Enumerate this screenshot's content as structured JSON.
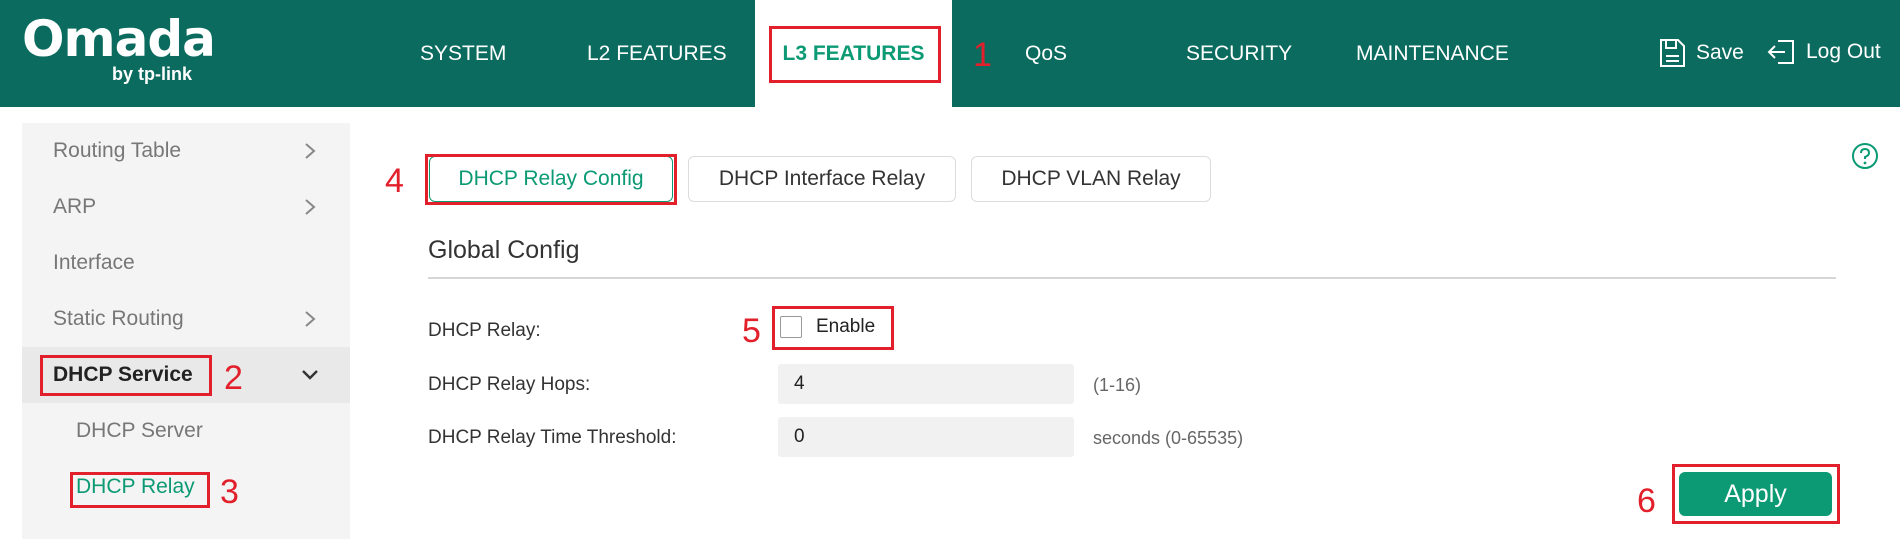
{
  "header": {
    "logo_text": "Omada",
    "logo_sub": "by tp-link",
    "nav": [
      {
        "label": "SYSTEM"
      },
      {
        "label": "L2 FEATURES"
      },
      {
        "label": "L3 FEATURES",
        "active": true
      },
      {
        "label": "QoS"
      },
      {
        "label": "SECURITY"
      },
      {
        "label": "MAINTENANCE"
      }
    ],
    "save_label": "Save",
    "save_icon": "save-icon",
    "logout_label": "Log Out",
    "logout_icon": "logout-icon",
    "bg_color": "#0b6b5e"
  },
  "sidebar": {
    "items": [
      {
        "label": "Routing Table",
        "has_chevron": true
      },
      {
        "label": "ARP",
        "has_chevron": true
      },
      {
        "label": "Interface",
        "has_chevron": false
      },
      {
        "label": "Static Routing",
        "has_chevron": true
      },
      {
        "label": "DHCP Service",
        "expanded": true
      },
      {
        "label": "DHCP Server"
      },
      {
        "label": "DHCP Relay",
        "active": true
      }
    ]
  },
  "main": {
    "tabs": [
      {
        "label": "DHCP Relay Config",
        "active": true
      },
      {
        "label": "DHCP Interface Relay"
      },
      {
        "label": "DHCP VLAN Relay"
      }
    ],
    "section_title": "Global Config",
    "fields": {
      "relay_label": "DHCP Relay:",
      "enable_label": "Enable",
      "enable_checked": false,
      "hops_label": "DHCP Relay Hops:",
      "hops_value": "4",
      "hops_hint": "(1-16)",
      "threshold_label": "DHCP Relay Time Threshold:",
      "threshold_value": "0",
      "threshold_hint": "seconds (0-65535)"
    },
    "apply_label": "Apply",
    "help_icon": "help-icon"
  },
  "annotations": {
    "steps": [
      "1",
      "2",
      "3",
      "4",
      "5",
      "6"
    ],
    "color": "#e2202b"
  },
  "colors": {
    "accent": "#0b9a74",
    "header": "#0b6b5e",
    "annotation": "#e2202b"
  }
}
